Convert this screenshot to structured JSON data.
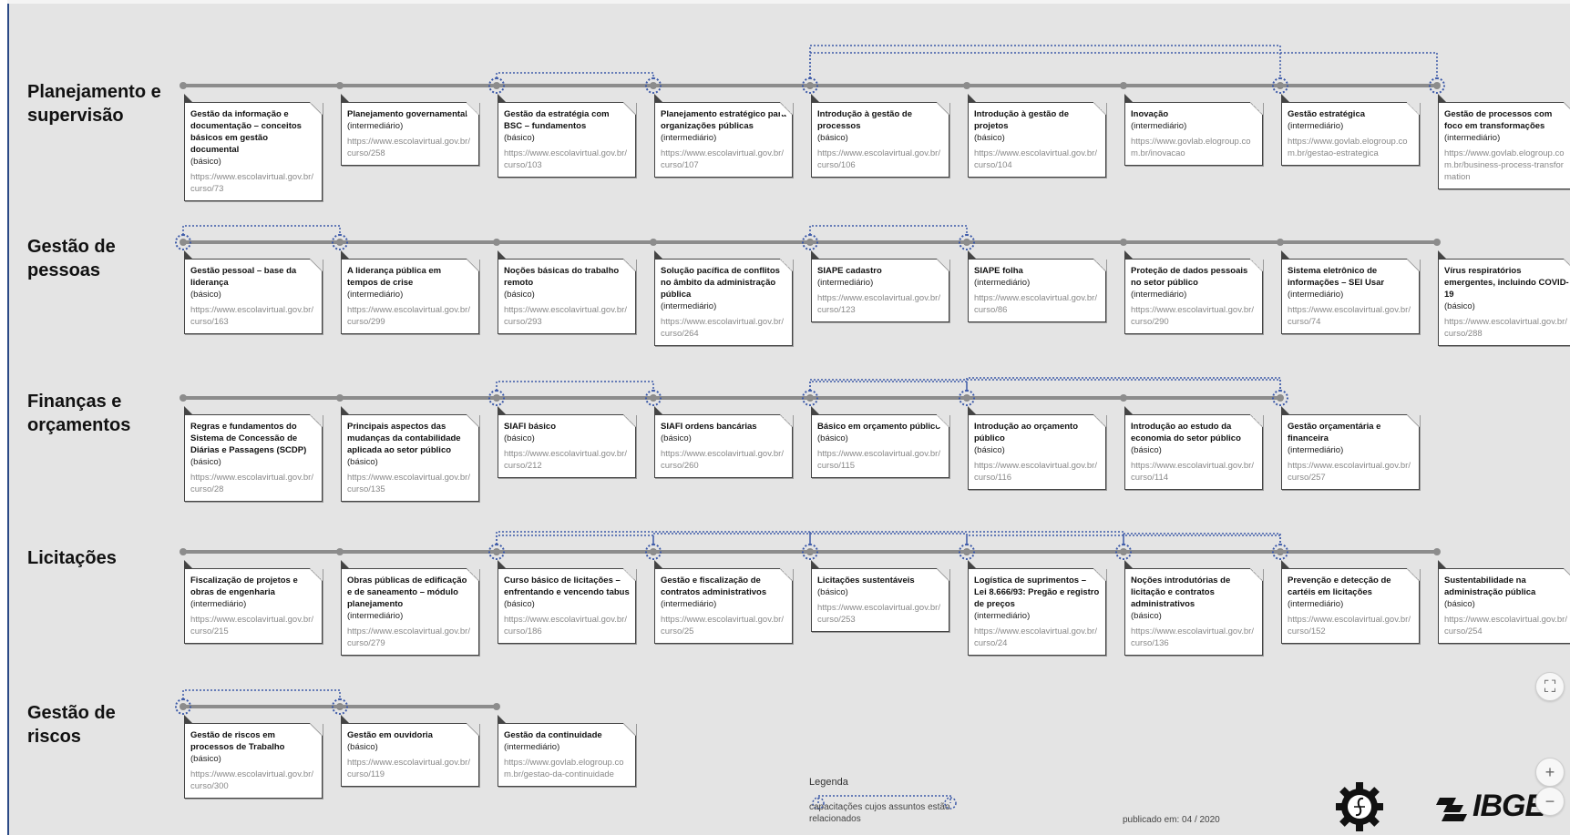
{
  "rows": [
    {
      "title": "Planejamento e\nsupervisão",
      "courses": [
        {
          "title": "Gestão da informação e documentação – conceitos básicos em gestão documental",
          "level": "(básico)",
          "url": "https://www.escolavirtual.gov.br/curso/73"
        },
        {
          "title": "Planejamento governamental",
          "level": "(intermediário)",
          "url": "https://www.escolavirtual.gov.br/curso/258"
        },
        {
          "title": "Gestão da estratégia com BSC – fundamentos",
          "level": "(básico)",
          "url": "https://www.escolavirtual.gov.br/curso/103"
        },
        {
          "title": "Planejamento estratégico para organizações públicas",
          "level": "(intermediário)",
          "url": "https://www.escolavirtual.gov.br/curso/107"
        },
        {
          "title": "Introdução à gestão de processos",
          "level": "(básico)",
          "url": "https://www.escolavirtual.gov.br/curso/106"
        },
        {
          "title": "Introdução à gestão de projetos",
          "level": "(básico)",
          "url": "https://www.escolavirtual.gov.br/curso/104"
        },
        {
          "title": "Inovação",
          "level": "(intermediário)",
          "url": "https://www.govlab.elogroup.com.br/inovacao"
        },
        {
          "title": "Gestão estratégica",
          "level": "(intermediário)",
          "url": "https://www.govlab.elogroup.com.br/gestao-estrategica"
        },
        {
          "title": "Gestão de processos com foco em transformações",
          "level": "(intermediário)",
          "url": "https://www.govlab.elogroup.com.br/business-process-transformation"
        }
      ]
    },
    {
      "title": "Gestão de\npessoas",
      "courses": [
        {
          "title": "Gestão pessoal – base da liderança",
          "level": "(básico)",
          "url": "https://www.escolavirtual.gov.br/curso/163"
        },
        {
          "title": "A liderança pública em tempos de crise",
          "level": "(intermediário)",
          "url": "https://www.escolavirtual.gov.br/curso/299"
        },
        {
          "title": "Noções básicas do trabalho remoto",
          "level": "(básico)",
          "url": "https://www.escolavirtual.gov.br/curso/293"
        },
        {
          "title": "Solução pacífica de conflitos no âmbito da administração pública",
          "level": "(intermediário)",
          "url": "https://www.escolavirtual.gov.br/curso/264"
        },
        {
          "title": "SIAPE cadastro",
          "level": "(intermediário)",
          "url": "https://www.escolavirtual.gov.br/curso/123"
        },
        {
          "title": "SIAPE folha",
          "level": "(intermediário)",
          "url": "https://www.escolavirtual.gov.br/curso/86"
        },
        {
          "title": "Proteção de dados pessoais no setor público",
          "level": "(intermediário)",
          "url": "https://www.escolavirtual.gov.br/curso/290"
        },
        {
          "title": "Sistema eletrônico de informações – SEI Usar",
          "level": "(intermediário)",
          "url": "https://www.escolavirtual.gov.br/curso/74"
        },
        {
          "title": "Vírus respiratórios emergentes, incluindo COVID-19",
          "level": "(básico)",
          "url": "https://www.escolavirtual.gov.br/curso/288"
        }
      ]
    },
    {
      "title": "Finanças e\norçamentos",
      "courses": [
        {
          "title": "Regras e fundamentos do Sistema de Concessão de Diárias e Passagens (SCDP)",
          "level": "(básico)",
          "url": "https://www.escolavirtual.gov.br/curso/28"
        },
        {
          "title": "Principais aspectos das mudanças da contabilidade aplicada ao setor público",
          "level": "(básico)",
          "url": "https://www.escolavirtual.gov.br/curso/135"
        },
        {
          "title": "SIAFI básico",
          "level": "(básico)",
          "url": "https://www.escolavirtual.gov.br/curso/212"
        },
        {
          "title": "SIAFI ordens bancárias",
          "level": "(básico)",
          "url": "https://www.escolavirtual.gov.br/curso/260"
        },
        {
          "title": "Básico em orçamento público",
          "level": "(básico)",
          "url": "https://www.escolavirtual.gov.br/curso/115"
        },
        {
          "title": "Introdução ao orçamento público",
          "level": "(básico)",
          "url": "https://www.escolavirtual.gov.br/curso/116"
        },
        {
          "title": "Introdução ao estudo da economia do setor público",
          "level": "(básico)",
          "url": "https://www.escolavirtual.gov.br/curso/114"
        },
        {
          "title": "Gestão orçamentária e financeira",
          "level": "(intermediário)",
          "url": "https://www.escolavirtual.gov.br/curso/257"
        }
      ]
    },
    {
      "title": "Licitações",
      "courses": [
        {
          "title": "Fiscalização de projetos e obras de engenharia",
          "level": "(intermediário)",
          "url": "https://www.escolavirtual.gov.br/curso/215"
        },
        {
          "title": "Obras públicas de edificação e de saneamento – módulo planejamento",
          "level": "(intermediário)",
          "url": "https://www.escolavirtual.gov.br/curso/279"
        },
        {
          "title": "Curso básico de licitações – enfrentando e vencendo tabus",
          "level": "(básico)",
          "url": "https://www.escolavirtual.gov.br/curso/186"
        },
        {
          "title": "Gestão e fiscalização de contratos administrativos",
          "level": "(intermediário)",
          "url": "https://www.escolavirtual.gov.br/curso/25"
        },
        {
          "title": "Licitações sustentáveis",
          "level": "(básico)",
          "url": "https://www.escolavirtual.gov.br/curso/253"
        },
        {
          "title": "Logística de suprimentos – Lei 8.666/93: Pregão e registro de preços",
          "level": "(intermediário)",
          "url": "https://www.escolavirtual.gov.br/curso/24"
        },
        {
          "title": "Noções introdutórias de licitação e contratos administrativos",
          "level": "(básico)",
          "url": "https://www.escolavirtual.gov.br/curso/136"
        },
        {
          "title": "Prevenção e detecção de cartéis em licitações",
          "level": "(intermediário)",
          "url": "https://www.escolavirtual.gov.br/curso/152"
        },
        {
          "title": "Sustentabilidade na administração pública",
          "level": "(básico)",
          "url": "https://www.escolavirtual.gov.br/curso/254"
        }
      ]
    },
    {
      "title": "Gestão de riscos",
      "courses": [
        {
          "title": "Gestão de riscos em processos de Trabalho",
          "level": "(básico)",
          "url": "https://www.escolavirtual.gov.br/curso/300"
        },
        {
          "title": "Gestão em ouvidoria",
          "level": "(básico)",
          "url": "https://www.escolavirtual.gov.br/curso/119"
        },
        {
          "title": "Gestão da continuidade",
          "level": "(intermediário)",
          "url": "https://www.govlab.elogroup.com.br/gestao-da-continuidade"
        }
      ]
    }
  ],
  "legend": {
    "title": "Legenda",
    "description": "capacitações cujos assuntos estão relacionados"
  },
  "published": "publicado em: 04 / 2020",
  "logo_text": "IBGE",
  "controls": {
    "fullscreen": "⛶",
    "zoom_in": "+",
    "zoom_out": "−"
  },
  "colors": {
    "related_link": "#3d5aa8",
    "track": "#8c8c8c",
    "background": "#e4e4e4"
  }
}
